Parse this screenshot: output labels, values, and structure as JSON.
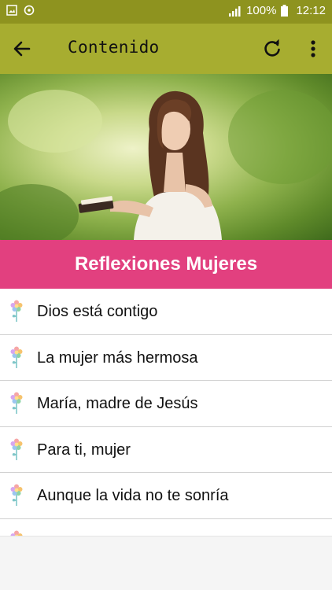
{
  "status_bar": {
    "battery": "100%",
    "time": "12:12"
  },
  "app_bar": {
    "title": "Contenido"
  },
  "banner": {
    "title": "Reflexiones Mujeres"
  },
  "list": {
    "items": [
      "Dios está contigo",
      "La mujer más hermosa",
      "María, madre de Jesús",
      "Para ti, mujer",
      "Aunque la vida no te sonría"
    ]
  },
  "colors": {
    "app_bar": "#a7ad30",
    "status_bar": "#8e931f",
    "banner": "#e2407f"
  },
  "icons": {
    "back": "back-arrow-icon",
    "refresh": "refresh-icon",
    "more": "more-vertical-icon",
    "list_item": "flower-icon"
  }
}
